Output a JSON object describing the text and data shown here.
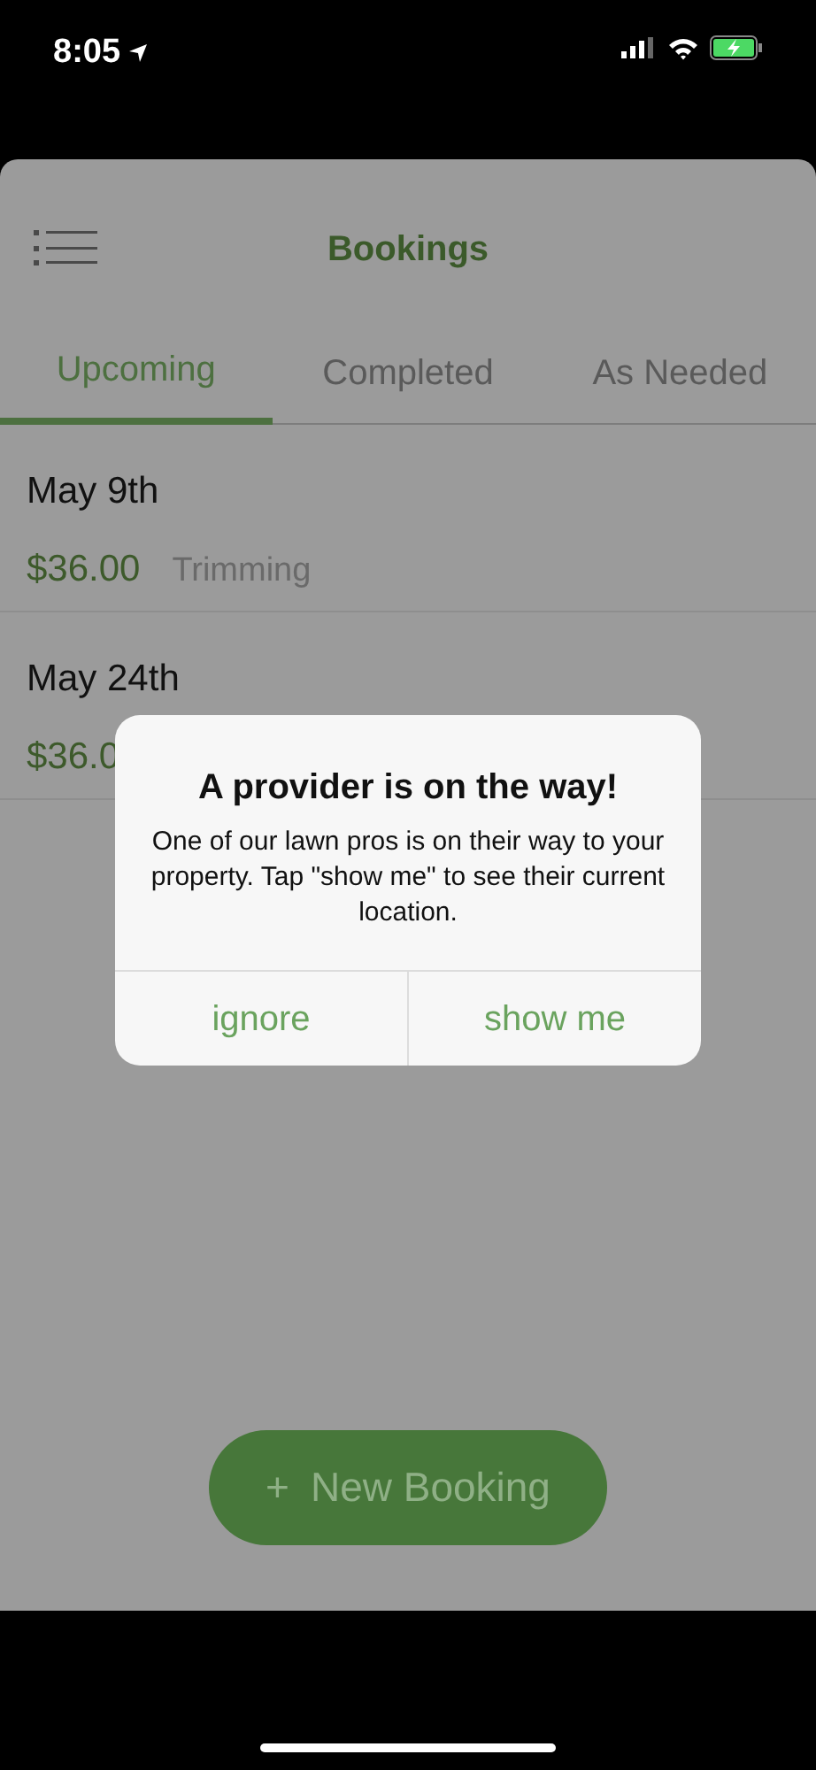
{
  "status_bar": {
    "time": "8:05"
  },
  "header": {
    "title": "Bookings"
  },
  "tabs": [
    {
      "label": "Upcoming",
      "selected": true
    },
    {
      "label": "Completed",
      "selected": false
    },
    {
      "label": "As Needed",
      "selected": false
    }
  ],
  "bookings": [
    {
      "date": "May 9th",
      "price": "$36.00",
      "service": "Trimming"
    },
    {
      "date": "May 24th",
      "price": "$36.0"
    }
  ],
  "alert": {
    "title": "A provider is on the way!",
    "message": "One of our lawn pros is on their way to your property. Tap \"show me\" to see their current location.",
    "buttons": [
      "ignore",
      "show me"
    ]
  },
  "new_booking_button": {
    "icon": "+",
    "label": "New Booking"
  }
}
